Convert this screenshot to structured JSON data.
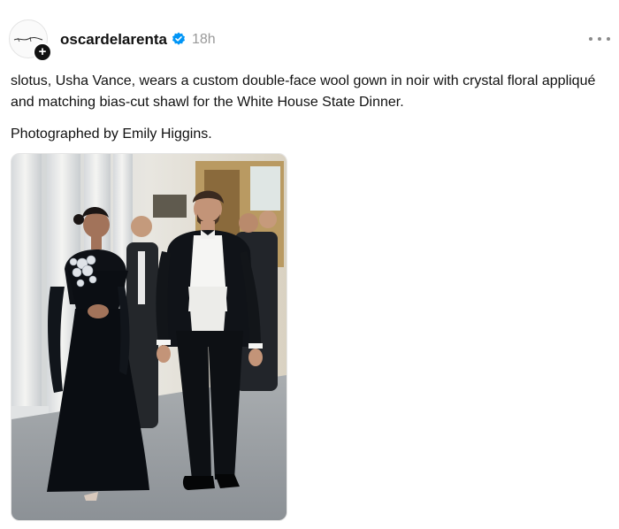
{
  "post": {
    "username": "oscardelarenta",
    "time": "18h",
    "caption": "slotus, Usha Vance, wears a custom double-face wool gown in noir with crystal floral appliqué and matching bias-cut shawl for the White House State Dinner.",
    "credit": "Photographed by Emily Higgins."
  },
  "icons": {
    "verified": "verified-badge-icon",
    "follow": "plus-icon",
    "more": "more-icon"
  },
  "colors": {
    "verified": "#0095f6",
    "text": "#111111",
    "muted": "#999999"
  }
}
